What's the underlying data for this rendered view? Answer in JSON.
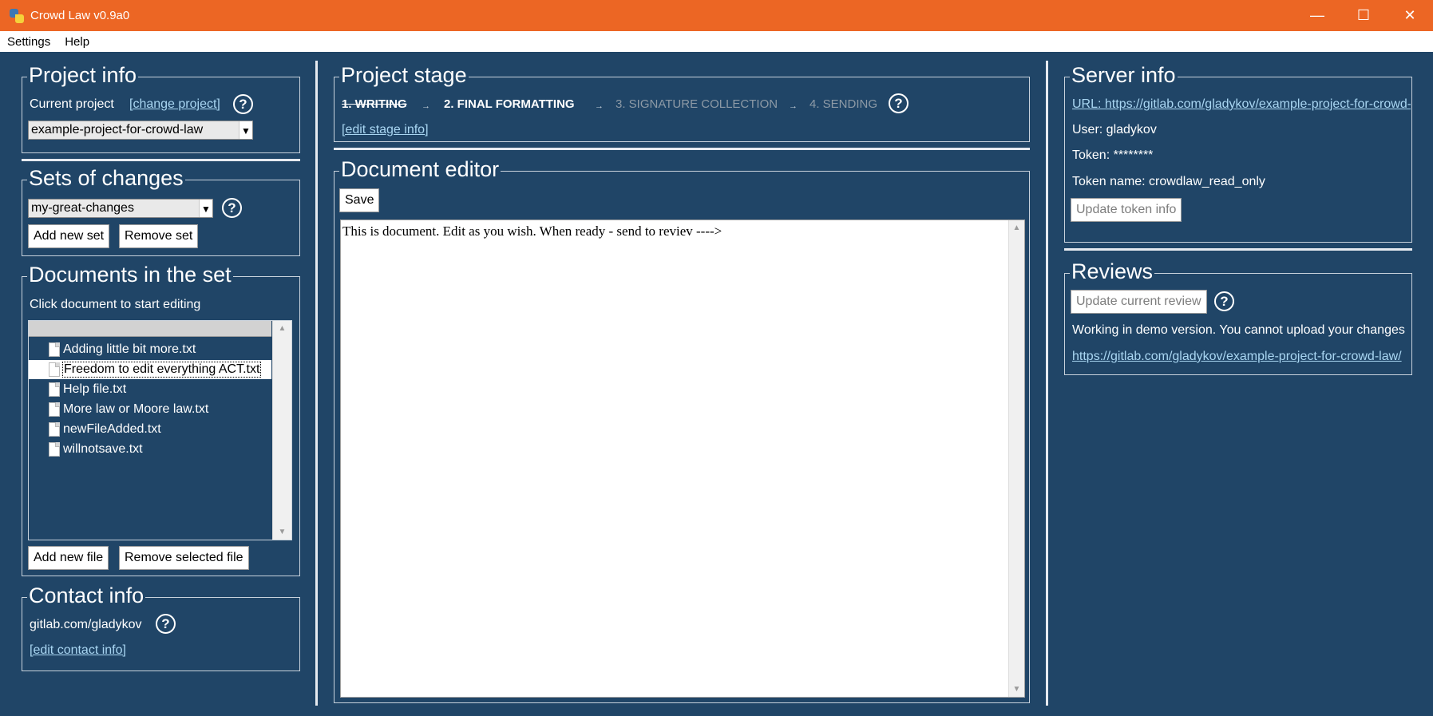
{
  "window": {
    "title": "Crowd Law v0.9a0",
    "minimize_glyph": "—",
    "maximize_glyph": "☐",
    "close_glyph": "✕"
  },
  "menu": {
    "settings": "Settings",
    "help": "Help"
  },
  "project_info": {
    "title": "Project info",
    "current_project_label": "Current project",
    "change_project_link": "[change project]",
    "project_value": "example-project-for-crowd-law",
    "help": "?"
  },
  "sets_of_changes": {
    "title": "Sets of changes",
    "selected_set": "my-great-changes",
    "add_button": "Add new set",
    "remove_button": "Remove set",
    "help": "?"
  },
  "documents": {
    "title": "Documents in the set",
    "hint": "Click document to start editing",
    "files": [
      "Adding little bit more.txt",
      "Freedom to edit everything ACT.txt",
      "Help file.txt",
      "More law or Moore law.txt",
      "newFileAdded.txt",
      "willnotsave.txt"
    ],
    "selected_index": 1,
    "add_button": "Add new file",
    "remove_button": "Remove selected file"
  },
  "contact_info": {
    "title": "Contact info",
    "contact": "gitlab.com/gladykov",
    "edit_link": "[edit contact info]",
    "help": "?"
  },
  "project_stage": {
    "title": "Project stage",
    "stages": [
      "1. WRITING",
      "2. FINAL FORMATTING",
      "3. SIGNATURE COLLECTION",
      "4. SENDING"
    ],
    "arrow": "→",
    "edit_link": "[edit stage info]",
    "help": "?"
  },
  "document_editor": {
    "title": "Document editor",
    "save_button": "Save",
    "content": "This is document. Edit as you wish. When ready - send to reviev ---->"
  },
  "server_info": {
    "title": "Server info",
    "url": "URL: https://gitlab.com/gladykov/example-project-for-crowd-law",
    "user": "User: gladykov",
    "token": "Token: ********",
    "token_name": "Token name: crowdlaw_read_only",
    "update_button": "Update token info"
  },
  "reviews": {
    "title": "Reviews",
    "update_button": "Update current review",
    "help": "?",
    "message": "Working in demo version. You cannot upload your changes",
    "link": "https://gitlab.com/gladykov/example-project-for-crowd-law/"
  },
  "colors": {
    "titlebar": "#ec6624",
    "background": "#204567",
    "link": "#a9d6f2"
  }
}
